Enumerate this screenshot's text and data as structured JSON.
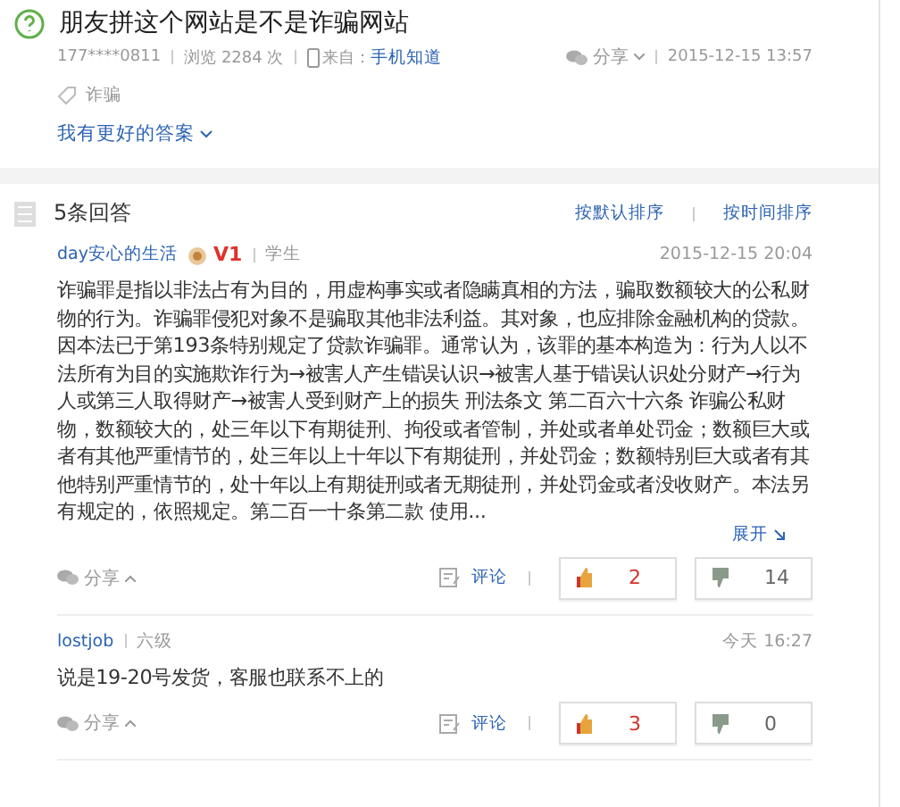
{
  "question": {
    "title": "朋友拼这个网站是不是诈骗网站",
    "user": "177****0811",
    "views": "浏览 2284 次",
    "source_label": "来自：",
    "source": "手机知道",
    "share": "分享",
    "date": "2015-12-15 13:57",
    "tags": [
      "诈骗"
    ],
    "better_answer": "我有更好的答案"
  },
  "answers_header": {
    "count": "5条回答",
    "sort_options": [
      "按默认排序",
      "按时间排序"
    ]
  },
  "answers": [
    {
      "user": "day安心的生活",
      "badge": "V1",
      "role": "学生",
      "date": "2015-12-15 20:04",
      "text": "诈骗罪是指以非法占有为目的，用虚构事实或者隐瞒真相的方法，骗取数额较大的公私财物的行为。诈骗罪侵犯对象不是骗取其他非法利益。其对象，也应排除金融机构的贷款。因本法已于第193条特别规定了贷款诈骗罪。通常认为，该罪的基本构造为：行为人以不法所有为目的实施欺诈行为→被害人产生错误认识→被害人基于错误认识处分财产→行为人或第三人取得财产→被害人受到财产上的损失 刑法条文 第二百六十六条 诈骗公私财物，数额较大的，处三年以下有期徒刑、拘役或者管制，并处或者单处罚金；数额巨大或者有其他严重情节的，处三年以上十年以下有期徒刑，并处罚金；数额特别巨大或者有其他特别严重情节的，处十年以上有期徒刑或者无期徒刑，并处罚金或者没收财产。本法另有规定的，依照规定。第二百一十条第二款 使用...",
      "expand": "展开",
      "share": "分享",
      "comment": "评论",
      "likes": "2",
      "dislikes": "14"
    },
    {
      "user": "lostjob",
      "role": "六级",
      "date": "今天 16:27",
      "text": "说是19-20号发货，客服也联系不上的",
      "share": "分享",
      "comment": "评论",
      "likes": "3",
      "dislikes": "0"
    }
  ]
}
